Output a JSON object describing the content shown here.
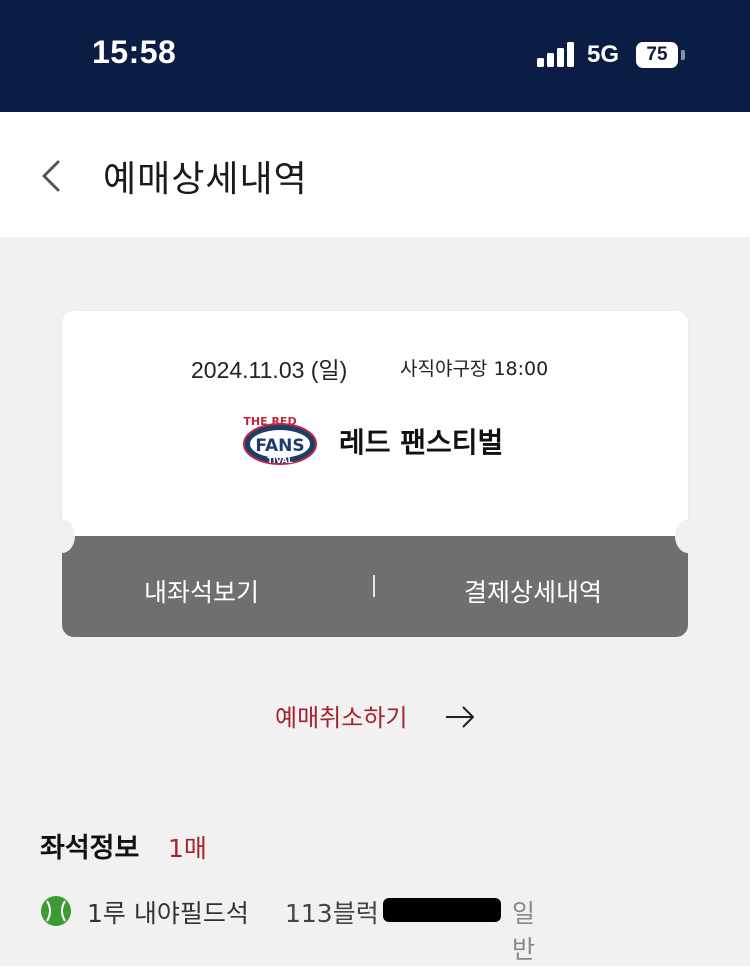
{
  "status_bar": {
    "time": "15:58",
    "network": "5G",
    "battery": "75"
  },
  "header": {
    "title": "예매상세내역",
    "back_icon": "chevron-left-icon"
  },
  "ticket": {
    "date": "2024.11.03 (일)",
    "venue_time": "사직야구장 18:00",
    "logo_text": {
      "top": "THE RED",
      "middle": "FANS",
      "bottom": "TIVAL"
    },
    "event_name": "레드 팬스티벌",
    "actions": {
      "view_seat": "내좌석보기",
      "divider": "|",
      "payment_detail": "결제상세내역"
    }
  },
  "cancel": {
    "label": "예매취소하기",
    "icon": "arrow-right-icon"
  },
  "seat_info": {
    "heading": "좌석정보",
    "count": "1매",
    "rows": [
      {
        "icon": "baseball-icon",
        "zone": "1루 내야필드석",
        "block": "113블럭",
        "type": "일반"
      }
    ]
  },
  "colors": {
    "status_bar_bg": "#0c1d45",
    "accent_red": "#a5242c",
    "ticket_bottom": "#6f6f6f",
    "ball_green": "#3d9b35"
  }
}
